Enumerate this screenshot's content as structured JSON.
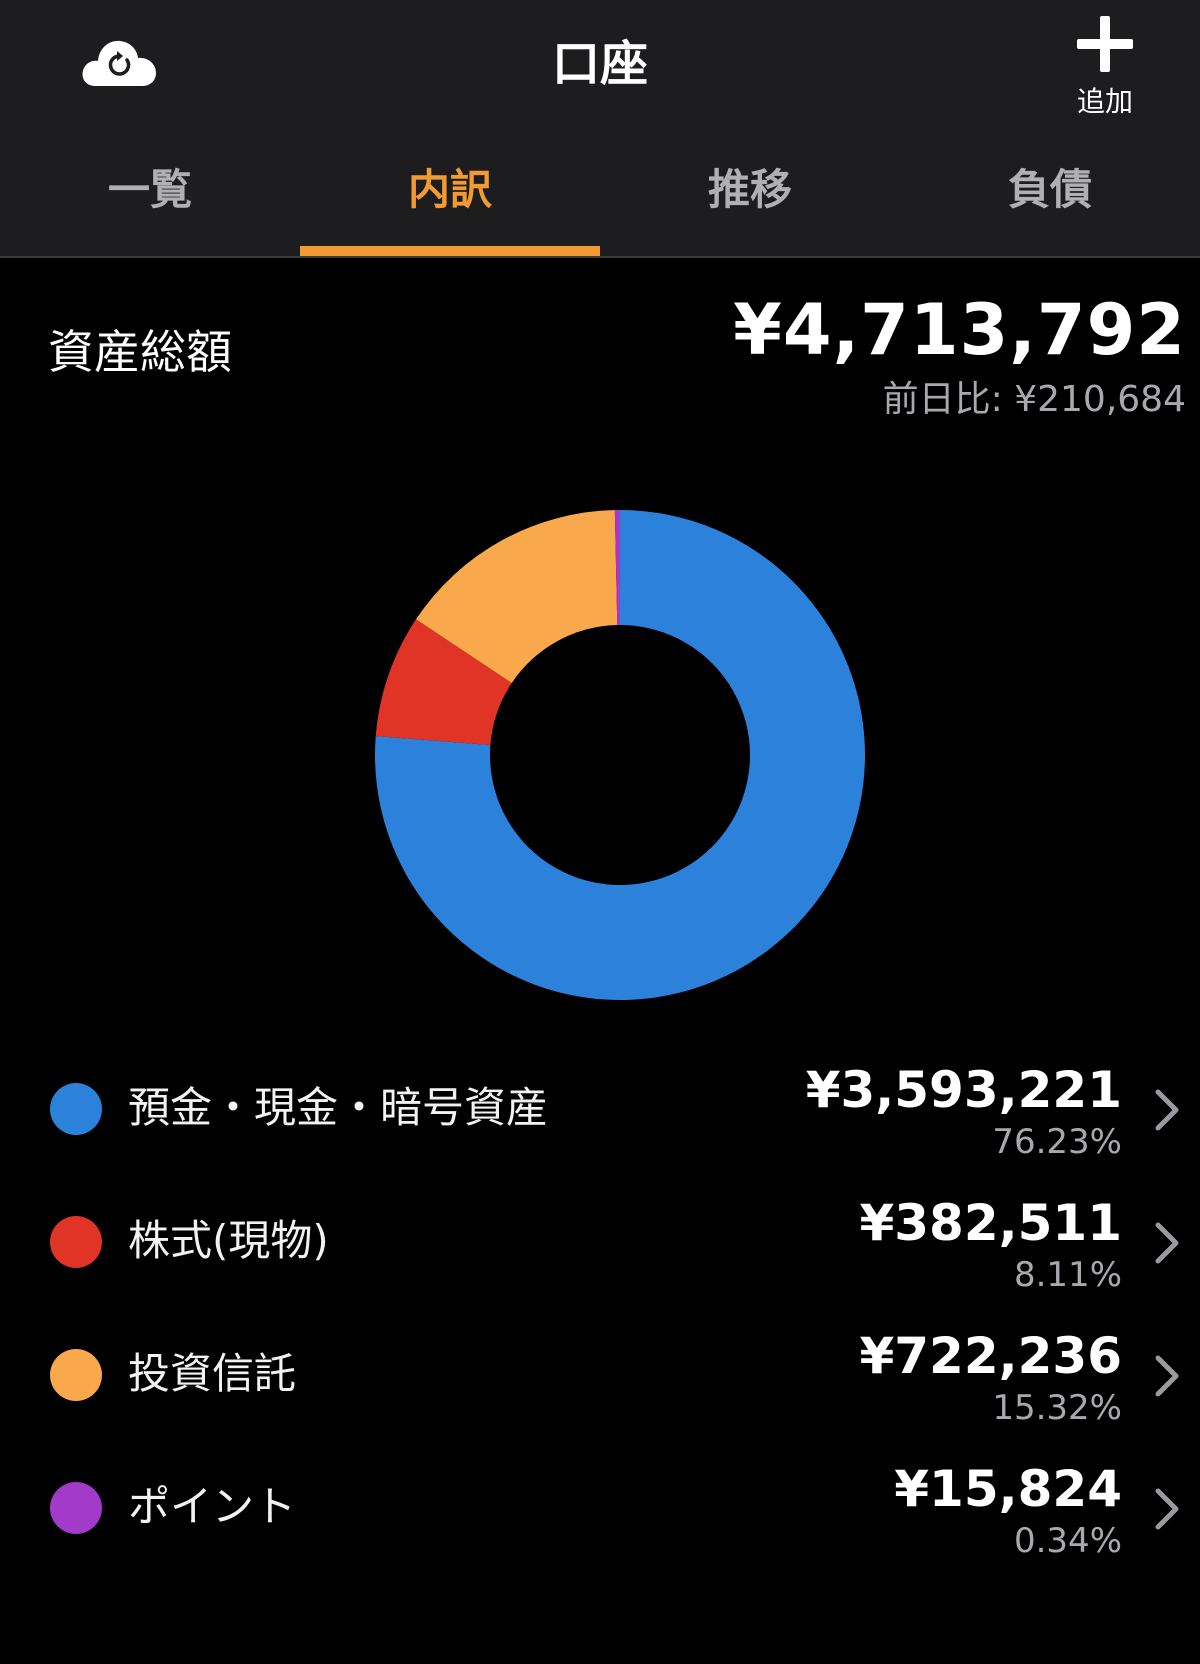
{
  "header": {
    "title": "口座",
    "refresh_icon": "cloud-refresh-icon",
    "add_icon": "plus-icon",
    "add_label": "追加"
  },
  "tabs": [
    {
      "label": "一覧",
      "active": false
    },
    {
      "label": "内訳",
      "active": true
    },
    {
      "label": "推移",
      "active": false
    },
    {
      "label": "負債",
      "active": false
    }
  ],
  "summary": {
    "label": "資産総額",
    "total": "¥4,713,792",
    "day_change": "前日比: ¥210,684"
  },
  "colors": {
    "accent": "#f29b33",
    "header_bg": "#1d1d1f",
    "background": "#000000"
  },
  "chart_data": {
    "type": "pie",
    "donut": true,
    "categories": [
      "預金・現金・暗号資産",
      "株式(現物)",
      "投資信託",
      "ポイント"
    ],
    "values": [
      3593221,
      382511,
      722236,
      15824
    ],
    "percents": [
      76.23,
      8.11,
      15.32,
      0.34
    ],
    "colors": [
      "#2c82db",
      "#e03526",
      "#f9a94b",
      "#a23bc9"
    ],
    "start_angle_deg": 0,
    "direction": "clockwise"
  },
  "legend": [
    {
      "name": "預金・現金・暗号資産",
      "amount": "¥3,593,221",
      "percent": "76.23%",
      "color": "#2c82db"
    },
    {
      "name": "株式(現物)",
      "amount": "¥382,511",
      "percent": "8.11%",
      "color": "#e03526"
    },
    {
      "name": "投資信託",
      "amount": "¥722,236",
      "percent": "15.32%",
      "color": "#f9a94b"
    },
    {
      "name": "ポイント",
      "amount": "¥15,824",
      "percent": "0.34%",
      "color": "#a23bc9"
    }
  ]
}
